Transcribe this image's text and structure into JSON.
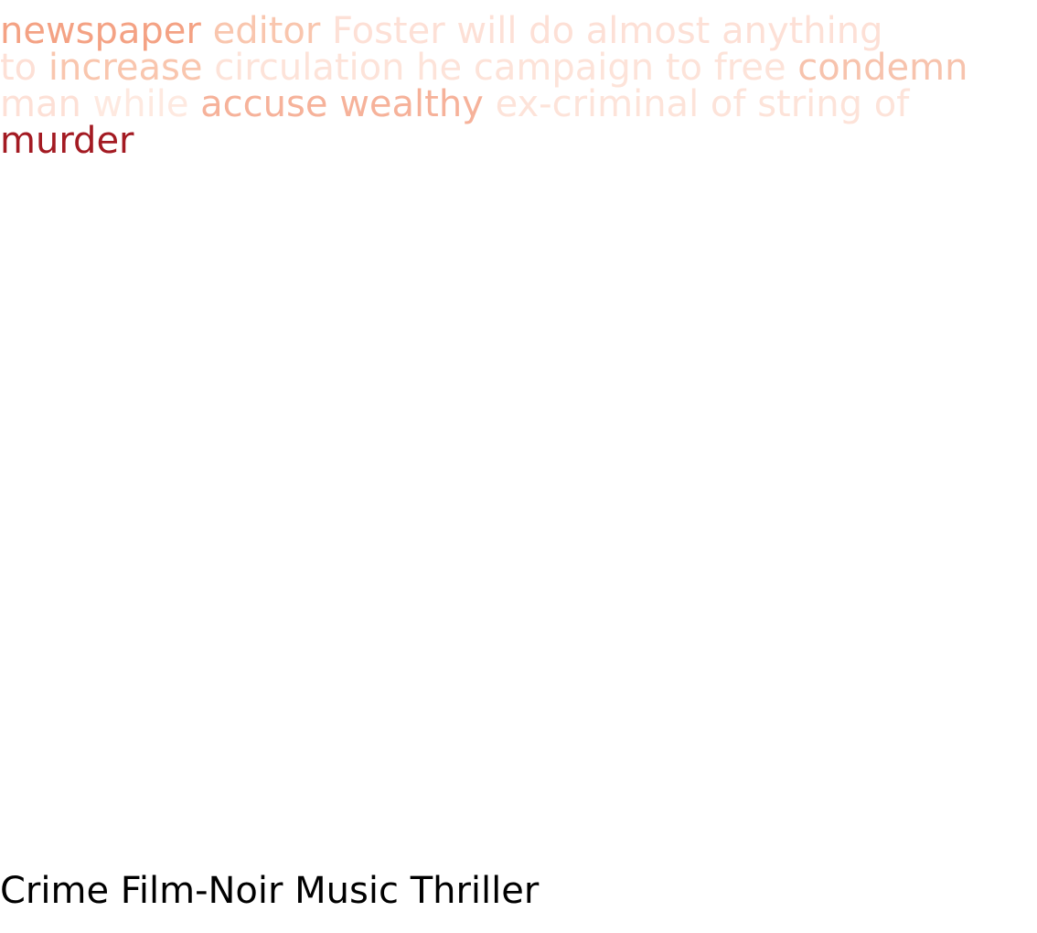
{
  "passage": {
    "lines": [
      [
        {
          "text": "newspaper",
          "color": "#f4a284"
        },
        {
          "text": "editor",
          "color": "#f9c6ae"
        },
        {
          "text": "Foster",
          "color": "#fde0d6"
        },
        {
          "text": "will",
          "color": "#fde0d6"
        },
        {
          "text": "do",
          "color": "#fde0d6"
        },
        {
          "text": "almost",
          "color": "#fde0d6"
        },
        {
          "text": "anything",
          "color": "#fde0d6"
        }
      ],
      [
        {
          "text": "to",
          "color": "#fde0d6"
        },
        {
          "text": "increase",
          "color": "#f9c6ae"
        },
        {
          "text": "circulation",
          "color": "#fde3d9"
        },
        {
          "text": "he",
          "color": "#fde3d9"
        },
        {
          "text": "campaign",
          "color": "#fde3d9"
        },
        {
          "text": "to",
          "color": "#fde3d9"
        },
        {
          "text": "free",
          "color": "#fde3d9"
        },
        {
          "text": "condemn",
          "color": "#f7c3ad"
        }
      ],
      [
        {
          "text": "man",
          "color": "#fde0d6"
        },
        {
          "text": "while",
          "color": "#fee9e0"
        },
        {
          "text": "accuse",
          "color": "#f6b29a"
        },
        {
          "text": "wealthy",
          "color": "#f6b29a"
        },
        {
          "text": "ex-criminal",
          "color": "#fde3d9"
        },
        {
          "text": "of",
          "color": "#fde3d9"
        },
        {
          "text": "string",
          "color": "#fde3d9"
        },
        {
          "text": "of",
          "color": "#fde3d9"
        }
      ],
      [
        {
          "text": "murder",
          "color": "#a31a22"
        }
      ]
    ]
  },
  "genres": "Crime Film-Noir Music Thriller"
}
